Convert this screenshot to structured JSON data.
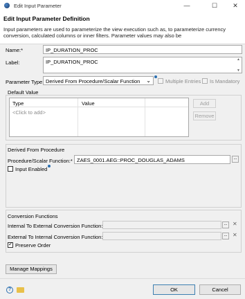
{
  "window": {
    "title": "Edit Input Parameter",
    "minimize": "—",
    "maximize": "☐",
    "close": "✕"
  },
  "header": {
    "title": "Edit Input Parameter Definition",
    "description": "Input parameters are used to parameterize the view execution such as, to parameterize currency conversion, calculated columns or inner filters. Parameter values may also be"
  },
  "form": {
    "name_label": "Name:*",
    "name_value": "IP_DURATION_PROC",
    "label_label": "Label:",
    "label_value": "IP_DURATION_PROC",
    "param_type_label": "Parameter Type:",
    "param_type_value": "Derived From Procedure/Scalar Function",
    "multiple_entries_label": "Multiple Entries",
    "is_mandatory_label": "Is Mandatory"
  },
  "default_value": {
    "section_title": "Default Value",
    "columns": [
      "Type",
      "Value"
    ],
    "placeholder_row": "<Click to add>",
    "add_label": "Add",
    "remove_label": "Remove"
  },
  "derived": {
    "section_title": "Derived From Procedure",
    "proc_label": "Procedure/Scalar Function:*",
    "proc_value": "ZAES_0001.AEG::PROC_DOUGLAS_ADAMS",
    "input_enabled_label": "Input Enabled"
  },
  "conversion": {
    "section_title": "Conversion Functions",
    "int_to_ext_label": "Internal To External Conversion Function:",
    "ext_to_int_label": "External To Internal Conversion Function:",
    "preserve_order_label": "Preserve Order",
    "browse_label": "...",
    "clear_label": "✕"
  },
  "footer": {
    "manage_mappings_label": "Manage Mappings",
    "help_icon": "?",
    "ok_label": "OK",
    "cancel_label": "Cancel"
  },
  "colors": {
    "accent": "#3c7fb1",
    "help": "#2a6fb0",
    "folder": "#e8c04a"
  }
}
